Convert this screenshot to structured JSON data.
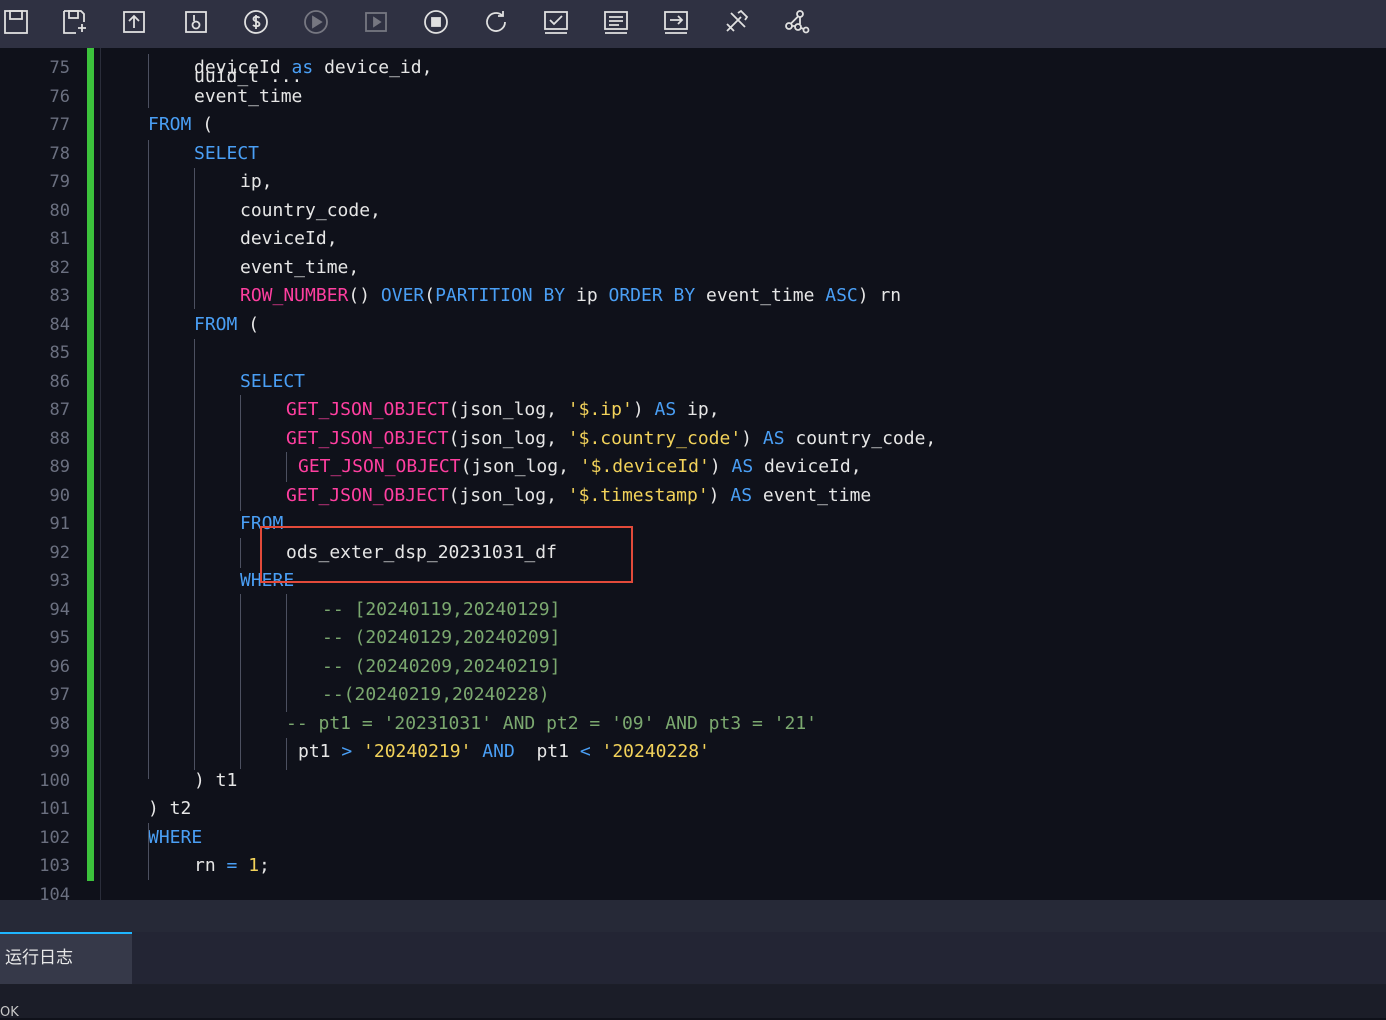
{
  "toolbar": {
    "buttons": [
      {
        "name": "save-icon",
        "enabled": true
      },
      {
        "name": "save-as-icon",
        "enabled": true
      },
      {
        "name": "submit-icon",
        "enabled": true
      },
      {
        "name": "steal-lock-icon",
        "enabled": true
      },
      {
        "name": "cost-estimate-icon",
        "enabled": true
      },
      {
        "name": "run-icon",
        "enabled": false
      },
      {
        "name": "advanced-run-icon",
        "enabled": false
      },
      {
        "name": "stop-icon",
        "enabled": true
      },
      {
        "name": "reload-icon",
        "enabled": true
      },
      {
        "name": "check-icon",
        "enabled": true
      },
      {
        "name": "format-icon",
        "enabled": true
      },
      {
        "name": "export-icon",
        "enabled": true
      },
      {
        "name": "tools-icon",
        "enabled": true
      },
      {
        "name": "lineage-icon",
        "enabled": true
      }
    ]
  },
  "editor": {
    "partial_top_line": "uuid_t ...",
    "lines": [
      {
        "n": "75",
        "segs": [
          [
            "t",
            "deviceId "
          ],
          [
            "kw",
            "as"
          ],
          [
            "t",
            " device_id,"
          ]
        ]
      },
      {
        "n": "76",
        "segs": [
          [
            "t",
            "event_time"
          ]
        ]
      },
      {
        "n": "77",
        "segs": [
          [
            "kw",
            "FROM"
          ],
          [
            "t",
            " ("
          ]
        ]
      },
      {
        "n": "78",
        "segs": [
          [
            "kw",
            "SELECT"
          ]
        ]
      },
      {
        "n": "79",
        "segs": [
          [
            "t",
            "ip,"
          ]
        ]
      },
      {
        "n": "80",
        "segs": [
          [
            "t",
            "country_code,"
          ]
        ]
      },
      {
        "n": "81",
        "segs": [
          [
            "t",
            "deviceId,"
          ]
        ]
      },
      {
        "n": "82",
        "segs": [
          [
            "t",
            "event_time,"
          ]
        ]
      },
      {
        "n": "83",
        "segs": [
          [
            "fn",
            "ROW_NUMBER"
          ],
          [
            "t",
            "() "
          ],
          [
            "kw",
            "OVER"
          ],
          [
            "t",
            "("
          ],
          [
            "kw",
            "PARTITION BY"
          ],
          [
            "t",
            " ip "
          ],
          [
            "kw",
            "ORDER BY"
          ],
          [
            "t",
            " event_time "
          ],
          [
            "kw",
            "ASC"
          ],
          [
            "t",
            ") rn"
          ]
        ]
      },
      {
        "n": "84",
        "segs": [
          [
            "kw",
            "FROM"
          ],
          [
            "t",
            " ("
          ]
        ]
      },
      {
        "n": "85",
        "segs": []
      },
      {
        "n": "86",
        "segs": [
          [
            "kw",
            "SELECT"
          ]
        ]
      },
      {
        "n": "87",
        "segs": [
          [
            "fn",
            "GET_JSON_OBJECT"
          ],
          [
            "t",
            "(json_log, "
          ],
          [
            "str",
            "'$.ip'"
          ],
          [
            "t",
            ") "
          ],
          [
            "kw",
            "AS"
          ],
          [
            "t",
            " ip,"
          ]
        ]
      },
      {
        "n": "88",
        "segs": [
          [
            "fn",
            "GET_JSON_OBJECT"
          ],
          [
            "t",
            "(json_log, "
          ],
          [
            "str",
            "'$.country_code'"
          ],
          [
            "t",
            ") "
          ],
          [
            "kw",
            "AS"
          ],
          [
            "t",
            " country_code,"
          ]
        ]
      },
      {
        "n": "89",
        "segs": [
          [
            "fn",
            "GET_JSON_OBJECT"
          ],
          [
            "t",
            "(json_log, "
          ],
          [
            "str",
            "'$.deviceId'"
          ],
          [
            "t",
            ") "
          ],
          [
            "kw",
            "AS"
          ],
          [
            "t",
            " deviceId,"
          ]
        ]
      },
      {
        "n": "90",
        "segs": [
          [
            "fn",
            "GET_JSON_OBJECT"
          ],
          [
            "t",
            "(json_log, "
          ],
          [
            "str",
            "'$.timestamp'"
          ],
          [
            "t",
            ") "
          ],
          [
            "kw",
            "AS"
          ],
          [
            "t",
            " event_time"
          ]
        ]
      },
      {
        "n": "91",
        "segs": [
          [
            "kw",
            "FROM"
          ]
        ]
      },
      {
        "n": "92",
        "segs": [
          [
            "t",
            "ods_exter_dsp_20231031_df"
          ]
        ]
      },
      {
        "n": "93",
        "segs": [
          [
            "kw",
            "WHERE"
          ]
        ]
      },
      {
        "n": "94",
        "segs": [
          [
            "cmt",
            "-- [20240119,20240129]"
          ]
        ]
      },
      {
        "n": "95",
        "segs": [
          [
            "cmt",
            "-- (20240129,20240209]"
          ]
        ]
      },
      {
        "n": "96",
        "segs": [
          [
            "cmt",
            "-- (20240209,20240219]"
          ]
        ]
      },
      {
        "n": "97",
        "segs": [
          [
            "cmt",
            "--(20240219,20240228)"
          ]
        ]
      },
      {
        "n": "98",
        "segs": [
          [
            "cmt",
            "-- pt1 = '20231031' AND pt2 = '09' AND pt3 = '21'"
          ]
        ]
      },
      {
        "n": "99",
        "segs": [
          [
            "t",
            "pt1 "
          ],
          [
            "kw",
            ">"
          ],
          [
            "t",
            " "
          ],
          [
            "str",
            "'20240219'"
          ],
          [
            "t",
            " "
          ],
          [
            "kw",
            "AND"
          ],
          [
            "t",
            "  pt1 "
          ],
          [
            "kw",
            "<"
          ],
          [
            "t",
            " "
          ],
          [
            "str",
            "'20240228'"
          ]
        ]
      },
      {
        "n": "100",
        "segs": [
          [
            "t",
            ") t1"
          ]
        ]
      },
      {
        "n": "101",
        "segs": [
          [
            "t",
            ") t2"
          ]
        ]
      },
      {
        "n": "102",
        "segs": [
          [
            "kw",
            "WHERE"
          ]
        ]
      },
      {
        "n": "103",
        "segs": [
          [
            "t",
            "rn "
          ],
          [
            "kw",
            "="
          ],
          [
            "t",
            " "
          ],
          [
            "num",
            "1"
          ],
          [
            "t",
            ";"
          ]
        ]
      },
      {
        "n": "104",
        "segs": []
      }
    ]
  },
  "bottom_panel": {
    "tab_label": "运行日志",
    "log_text": "OK"
  },
  "colors": {
    "background": "#0f111a",
    "keyword": "#4a9ff5",
    "function": "#ff3fa0",
    "string": "#f2d25a",
    "comment": "#7ba86f",
    "change_bar": "#3cc23c",
    "highlight_box": "#e24a3a",
    "active_tab_accent": "#1fb6ff"
  }
}
